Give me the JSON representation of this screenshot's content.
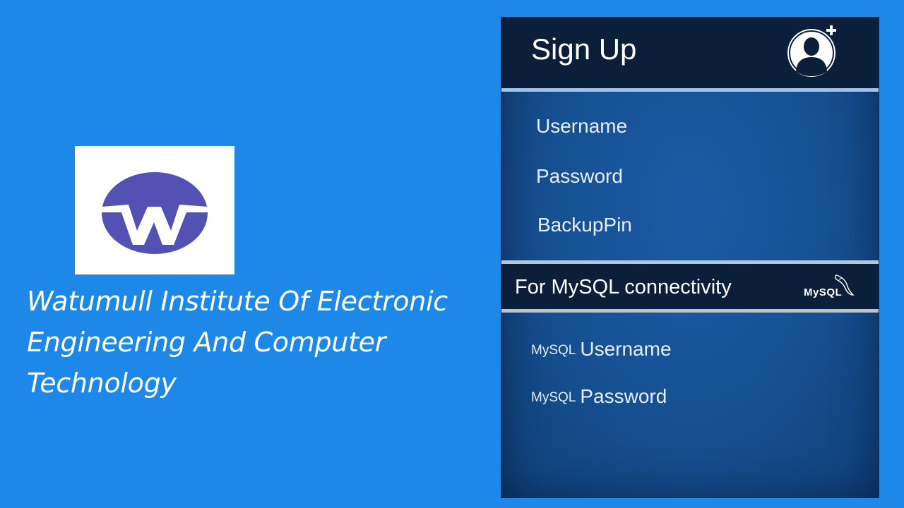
{
  "branding": {
    "logo_icon": "watumull-w-logo",
    "logo_colors": {
      "oval": "#5352b4",
      "letter": "#ffffff"
    },
    "institute_name": "Watumull Institute Of Electronic Engineering And Computer Technology"
  },
  "signup": {
    "title": "Sign Up",
    "icon": "add-user-icon",
    "fields": [
      {
        "label": "Username"
      },
      {
        "label": "Password"
      },
      {
        "label": "BackupPin"
      }
    ]
  },
  "mysql": {
    "section_title": "For MySQL connectivity",
    "logo_text": "MySQL",
    "logo_icon": "mysql-dolphin-icon",
    "fields": [
      {
        "prefix": "MySQL",
        "label": "Username"
      },
      {
        "prefix": "MySQL",
        "label": "Password"
      }
    ]
  },
  "colors": {
    "background": "#1e88e9",
    "panel_header": "#0b1f3a",
    "panel_body": "#165092",
    "header_divider": "#9fc3ec"
  }
}
